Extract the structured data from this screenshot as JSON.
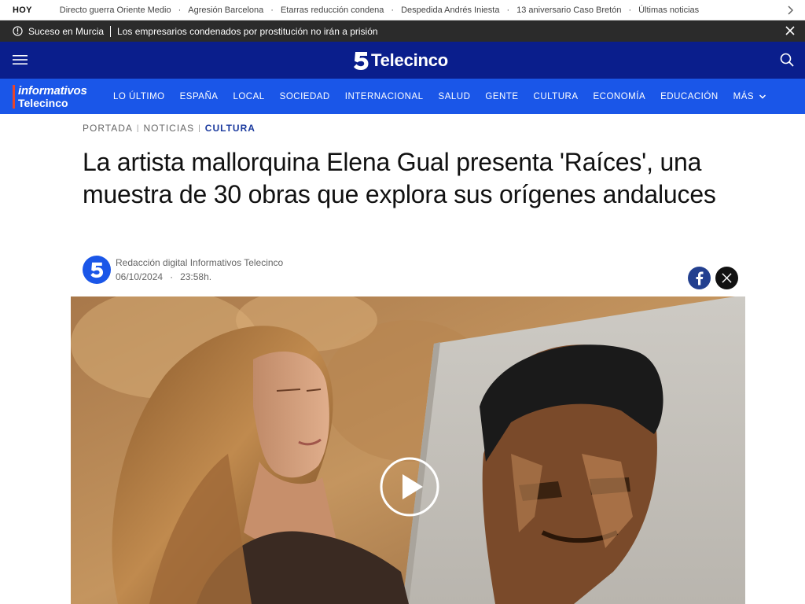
{
  "topbar": {
    "today_label": "HOY",
    "links": [
      "Directo guerra Oriente Medio",
      "Agresión Barcelona",
      "Etarras reducción condena",
      "Despedida Andrés Iniesta",
      "13 aniversario Caso Bretón",
      "Últimas noticias"
    ],
    "separator": "·"
  },
  "breaking": {
    "tag": "Suceso en Murcia",
    "message": "Los empresarios condenados por prostitución no irán a prisión"
  },
  "header": {
    "logo_text": "Telecinco"
  },
  "section_nav": {
    "brand_line1": "informativos",
    "brand_line2": "Telecinco",
    "items": [
      "LO ÚLTIMO",
      "ESPAÑA",
      "LOCAL",
      "SOCIEDAD",
      "INTERNACIONAL",
      "SALUD",
      "GENTE",
      "CULTURA",
      "ECONOMÍA",
      "EDUCACIÓN"
    ],
    "more_label": "MÁS"
  },
  "breadcrumb": {
    "items": [
      "PORTADA",
      "NOTICIAS",
      "CULTURA"
    ]
  },
  "article": {
    "title": "La artista mallorquina Elena Gual presenta 'Raíces', una muestra de 30 obras que explora sus orígenes andaluces",
    "author": "Redacción digital Informativos Telecinco",
    "date": "06/10/2024",
    "dot": "·",
    "time": "23:58h."
  },
  "icons": {
    "chevron": "chevron-right-icon",
    "info": "info-icon",
    "close": "close-icon",
    "menu": "hamburger-menu-icon",
    "search": "search-icon",
    "share_facebook": "facebook-icon",
    "share_x": "x-icon",
    "play": "play-icon"
  },
  "colors": {
    "header_bg": "#0a1e8c",
    "nav_bg": "#1a56e8",
    "breaking_bg": "#2b2b2b",
    "accent_red": "#e8452c",
    "crumb_active": "#1b3a9e"
  }
}
